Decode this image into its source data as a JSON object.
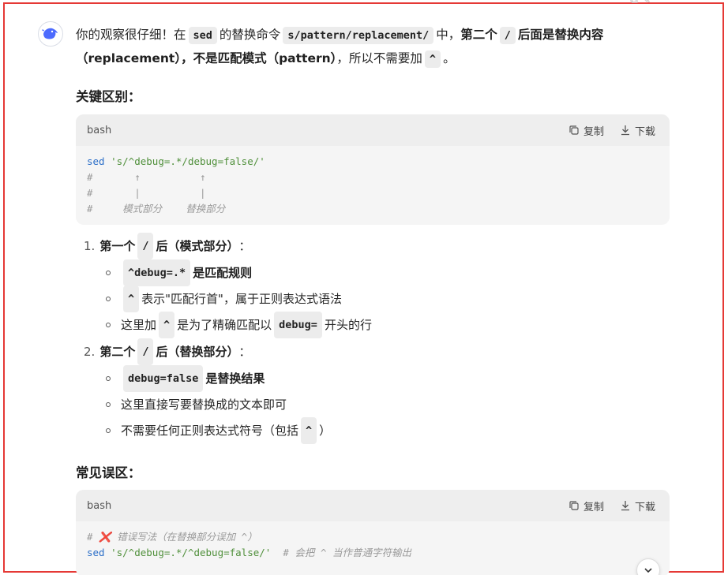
{
  "message": {
    "p1_a": "你的观察很仔细！在",
    "p1_code1": "sed",
    "p1_b": "的替换命令",
    "p1_code2": "s/pattern/replacement/",
    "p1_c": "中，",
    "p1_bold1": "第二个",
    "p1_code3": "/",
    "p1_bold2": "后面是替换内容",
    "p2_bold": "（replacement），不是匹配模式（pattern）",
    "p2_a": "，所以不需要加",
    "p2_code": "^",
    "p2_b": "。"
  },
  "section_key": "关键区别：",
  "code1": {
    "lang": "bash",
    "copy_label": "复制",
    "download_label": "下载",
    "line1_kw": "sed",
    "line1_str": "'s/^debug=.*/debug=false/'",
    "line2": "#       ↑          ↑",
    "line3": "#       |          |",
    "line4": "#     模式部分    替换部分"
  },
  "list": {
    "item1_num": "1.",
    "item1_bold": "第一个",
    "item1_code": "/",
    "item1_bold2": "后（模式部分）",
    "item1_tail": "：",
    "sub1_code": "^debug=.*",
    "sub1_text": "是匹配规则",
    "sub2_code": "^",
    "sub2_text": "表示\"匹配行首\"，属于正则表达式语法",
    "sub3_a": "这里加",
    "sub3_code": "^",
    "sub3_b": "是为了精确匹配以",
    "sub3_code2": "debug=",
    "sub3_c": "开头的行",
    "item2_num": "2.",
    "item2_bold": "第二个",
    "item2_code": "/",
    "item2_bold2": "后（替换部分）",
    "item2_tail": "：",
    "sub4_code": "debug=false",
    "sub4_text": "是替换结果",
    "sub5_text": "这里直接写要替换成的文本即可",
    "sub6_a": "不需要任何正则表达式符号（包括",
    "sub6_code": "^",
    "sub6_b": "）"
  },
  "section_mis": "常见误区：",
  "code2": {
    "lang": "bash",
    "copy_label": "复制",
    "download_label": "下载",
    "line1_cm": "# ❌ 错误写法（在替换部分误加 ^）",
    "line2_kw": "sed",
    "line2_str": "'s/^debug=.*/^debug=false/'",
    "line2_cm": "# 会把 ^ 当作普通字符输出"
  },
  "colors": {
    "frame": "#e53935",
    "code_bg": "#f5f5f5",
    "keyword": "#2b6ec8",
    "string": "#4f8f3a"
  }
}
